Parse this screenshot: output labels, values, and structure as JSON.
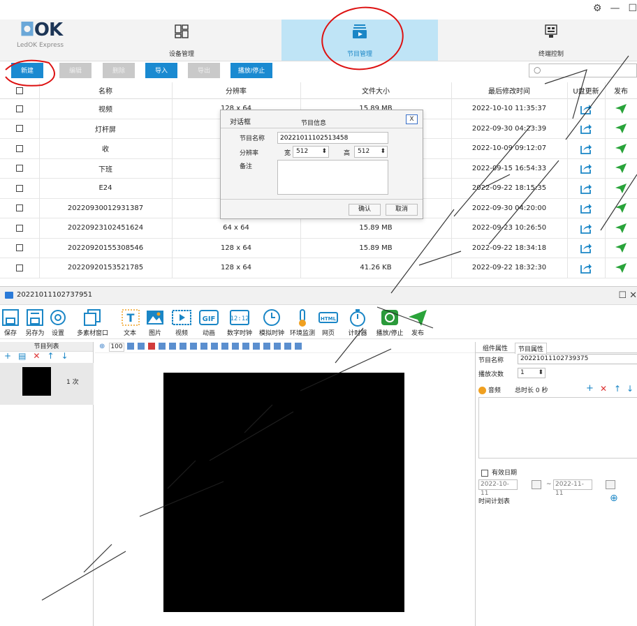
{
  "top": {
    "logo_mark": "OK",
    "logo_sub": "LedOK Express",
    "nav": [
      {
        "label": "设备管理",
        "icon": "device-grid-icon"
      },
      {
        "label": "节目管理",
        "icon": "program-play-icon"
      },
      {
        "label": "终端控制",
        "icon": "terminal-control-icon"
      }
    ],
    "toolbar": {
      "new": "新建",
      "edit": "编辑",
      "delete": "删除",
      "import": "导入",
      "export": "导出",
      "play_stop": "播放/停止"
    },
    "table": {
      "headers": [
        "名称",
        "分辨率",
        "文件大小",
        "最后修改时间",
        "U盘更新",
        "发布"
      ],
      "rows": [
        {
          "name": "视频",
          "resolution": "128 x 64",
          "size": "15.89 MB",
          "modified": "2022-10-10 11:35:37"
        },
        {
          "name": "灯杆屏",
          "resolution": "",
          "size": "",
          "modified": "2022-09-30 04:23:39"
        },
        {
          "name": "收",
          "resolution": "",
          "size": "",
          "modified": "2022-10-09 09:12:07"
        },
        {
          "name": "下班",
          "resolution": "",
          "size": "",
          "modified": "2022-09-15 16:54:33"
        },
        {
          "name": "E24",
          "resolution": "",
          "size": "",
          "modified": "2022-09-22 18:15:35"
        },
        {
          "name": "20220930012931387",
          "resolution": "",
          "size": "",
          "modified": "2022-09-30 04:20:00"
        },
        {
          "name": "20220923102451624",
          "resolution": "64 x 64",
          "size": "15.89 MB",
          "modified": "2022-09-23 10:26:50"
        },
        {
          "name": "20220920155308546",
          "resolution": "128 x 64",
          "size": "15.89 MB",
          "modified": "2022-09-22 18:34:18"
        },
        {
          "name": "20220920153521785",
          "resolution": "128 x 64",
          "size": "41.26 KB",
          "modified": "2022-09-22 18:32:30"
        }
      ]
    },
    "dialog": {
      "title": "对话框",
      "header": "节目信息",
      "close": "X",
      "name_label": "节目名称",
      "name_value": "20221011102513458",
      "res_label": "分辨率",
      "width_label": "宽",
      "width_value": "512",
      "height_label": "高",
      "height_value": "512",
      "note_label": "备注",
      "ok": "确认",
      "cancel": "取消"
    }
  },
  "bottom": {
    "title": "20221011102737951",
    "ribbon": [
      {
        "label": "保存",
        "icon": "save-icon"
      },
      {
        "label": "另存为",
        "icon": "save-as-icon"
      },
      {
        "label": "设置",
        "icon": "settings-icon"
      },
      {
        "label": "多素材窗口",
        "icon": "multi-window-icon"
      },
      {
        "label": "文本",
        "icon": "text-icon"
      },
      {
        "label": "图片",
        "icon": "image-icon"
      },
      {
        "label": "视频",
        "icon": "video-icon"
      },
      {
        "label": "动画",
        "icon": "gif-icon"
      },
      {
        "label": "数字时钟",
        "icon": "digital-clock-icon"
      },
      {
        "label": "模拟时钟",
        "icon": "analog-clock-icon"
      },
      {
        "label": "环境监测",
        "icon": "thermometer-icon"
      },
      {
        "label": "网页",
        "icon": "html-icon"
      },
      {
        "label": "计时器",
        "icon": "timer-icon"
      },
      {
        "label": "播放/停止",
        "icon": "play-stop-icon"
      },
      {
        "label": "发布",
        "icon": "publish-icon"
      }
    ],
    "left": {
      "title": "节目列表",
      "item_count": "1 次"
    },
    "zoom": "100",
    "right": {
      "tab1": "组件属性",
      "tab2": "节目属性",
      "name_label": "节目名称",
      "name_value": "20221011102739375",
      "plays_label": "播放次数",
      "plays_value": "1",
      "audio_label": "音频",
      "duration": "总时长 0 秒",
      "valid_label": "有效日期",
      "date_from": "2022-10-11",
      "date_to": "2022-11-11",
      "date_sep": "~",
      "schedule": "时间计划表"
    }
  }
}
